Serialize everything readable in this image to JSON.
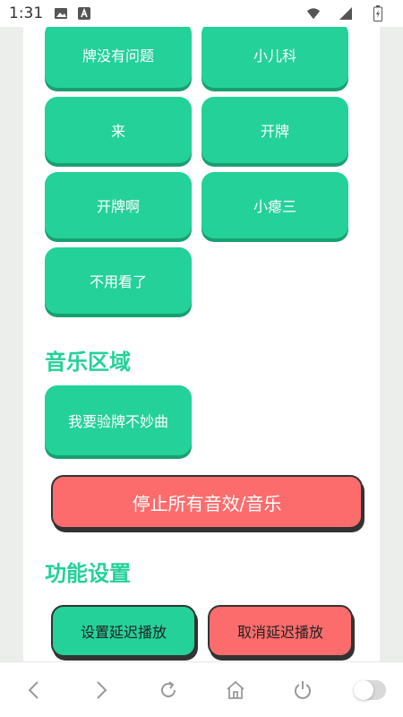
{
  "status_bar": {
    "time": "1:31"
  },
  "sound_buttons": [
    "牌没有问题",
    "小儿科",
    "来",
    "开牌",
    "开牌啊",
    "小瘪三",
    "不用看了"
  ],
  "music_section": {
    "title": "音乐区域",
    "button": "我要验牌不妙曲"
  },
  "stop_button": "停止所有音效/音乐",
  "settings_section": {
    "title": "功能设置",
    "delay_button": "设置延迟播放",
    "cancel_button": "取消延迟播放"
  },
  "colors": {
    "green": "#24d198",
    "red": "#fd6c6d"
  }
}
